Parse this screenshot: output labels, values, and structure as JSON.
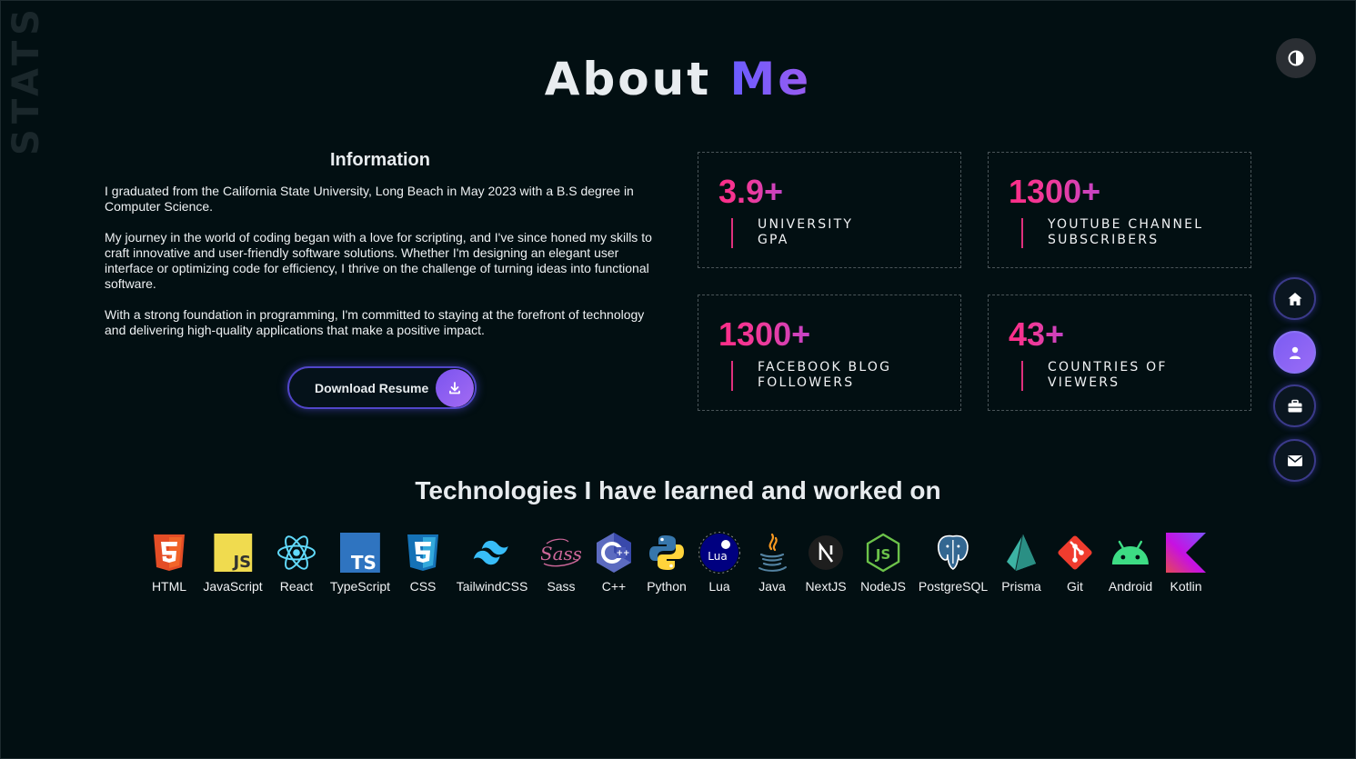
{
  "side_label": "STATS",
  "title": {
    "main": "About",
    "accent": "Me"
  },
  "info": {
    "heading": "Information",
    "paragraphs": [
      "I graduated from the California State University, Long Beach in May 2023 with a B.S degree in Computer Science.",
      "My journey in the world of coding began with a love for scripting, and I've since honed my skills to craft innovative and user-friendly software solutions. Whether I'm designing an elegant user interface or optimizing code for efficiency, I thrive on the challenge of turning ideas into functional software.",
      "With a strong foundation in programming, I'm committed to staying at the forefront of technology and delivering high-quality applications that make a positive impact."
    ],
    "download_label": "Download Resume"
  },
  "stats": [
    {
      "value": "3.9+",
      "line1": "UNIVERSITY",
      "line2": "GPA"
    },
    {
      "value": "1300+",
      "line1": "YOUTUBE CHANNEL",
      "line2": "SUBSCRIBERS"
    },
    {
      "value": "1300+",
      "line1": "FACEBOOK BLOG",
      "line2": "FOLLOWERS"
    },
    {
      "value": "43+",
      "line1": "COUNTRIES OF",
      "line2": "VIEWERS"
    }
  ],
  "nav": [
    {
      "icon": "home-icon",
      "active": false
    },
    {
      "icon": "user-icon",
      "active": true
    },
    {
      "icon": "briefcase-icon",
      "active": false
    },
    {
      "icon": "envelope-icon",
      "active": false
    }
  ],
  "tech_title": "Technologies I have learned and worked on",
  "technologies": [
    {
      "name": "HTML",
      "icon": "html5-icon"
    },
    {
      "name": "JavaScript",
      "icon": "javascript-icon"
    },
    {
      "name": "React",
      "icon": "react-icon"
    },
    {
      "name": "TypeScript",
      "icon": "typescript-icon"
    },
    {
      "name": "CSS",
      "icon": "css3-icon"
    },
    {
      "name": "TailwindCSS",
      "icon": "tailwind-icon"
    },
    {
      "name": "Sass",
      "icon": "sass-icon"
    },
    {
      "name": "C++",
      "icon": "cplusplus-icon"
    },
    {
      "name": "Python",
      "icon": "python-icon"
    },
    {
      "name": "Lua",
      "icon": "lua-icon"
    },
    {
      "name": "Java",
      "icon": "java-icon"
    },
    {
      "name": "NextJS",
      "icon": "nextjs-icon"
    },
    {
      "name": "NodeJS",
      "icon": "nodejs-icon"
    },
    {
      "name": "PostgreSQL",
      "icon": "postgresql-icon"
    },
    {
      "name": "Prisma",
      "icon": "prisma-icon"
    },
    {
      "name": "Git",
      "icon": "git-icon"
    },
    {
      "name": "Android",
      "icon": "android-icon"
    },
    {
      "name": "Kotlin",
      "icon": "kotlin-icon"
    }
  ],
  "colors": {
    "background": "#020f12",
    "accent_purple": "#6a5cff",
    "accent_pink": "#ff2d87"
  }
}
